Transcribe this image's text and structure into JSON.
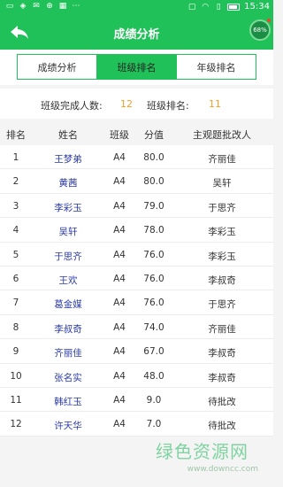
{
  "status_bar": {
    "time": "15:34",
    "icons": [
      "sim-icon",
      "shield-icon",
      "mail-icon",
      "globe-icon",
      "grid-icon",
      "dots-icon",
      "notification-icon",
      "wifi-icon",
      "sim-card-icon",
      "battery-icon"
    ]
  },
  "header": {
    "title": "成绩分析",
    "back_icon": "back-arrow-icon",
    "progress_badge": "68%"
  },
  "tabs": [
    {
      "label": "成绩分析",
      "active": false
    },
    {
      "label": "班级排名",
      "active": true
    },
    {
      "label": "年级排名",
      "active": false
    }
  ],
  "summary": {
    "completed_label": "班级完成人数:",
    "completed_value": "12",
    "rank_label": "班级排名:",
    "rank_value": "11"
  },
  "table": {
    "columns": [
      "排名",
      "姓名",
      "班级",
      "分值",
      "主观题批改人"
    ],
    "rows": [
      {
        "rank": "1",
        "name": "王梦弟",
        "class": "A4",
        "score": "80.0",
        "reviewer": "齐丽佳"
      },
      {
        "rank": "2",
        "name": "黄茜",
        "class": "A4",
        "score": "80.0",
        "reviewer": "吴轩"
      },
      {
        "rank": "3",
        "name": "李彩玉",
        "class": "A4",
        "score": "79.0",
        "reviewer": "于思齐"
      },
      {
        "rank": "4",
        "name": "吴轩",
        "class": "A4",
        "score": "78.0",
        "reviewer": "李彩玉"
      },
      {
        "rank": "5",
        "name": "于思齐",
        "class": "A4",
        "score": "76.0",
        "reviewer": "李彩玉"
      },
      {
        "rank": "6",
        "name": "王欢",
        "class": "A4",
        "score": "76.0",
        "reviewer": "李叔奇"
      },
      {
        "rank": "7",
        "name": "葛金媒",
        "class": "A4",
        "score": "76.0",
        "reviewer": "于思齐"
      },
      {
        "rank": "8",
        "name": "李叔奇",
        "class": "A4",
        "score": "74.0",
        "reviewer": "齐丽佳"
      },
      {
        "rank": "9",
        "name": "齐丽佳",
        "class": "A4",
        "score": "67.0",
        "reviewer": "李叔奇"
      },
      {
        "rank": "10",
        "name": "张名实",
        "class": "A4",
        "score": "48.0",
        "reviewer": "李叔奇"
      },
      {
        "rank": "11",
        "name": "韩红玉",
        "class": "A4",
        "score": "9.0",
        "reviewer": "待批改"
      },
      {
        "rank": "12",
        "name": "许天华",
        "class": "A4",
        "score": "7.0",
        "reviewer": "待批改"
      }
    ]
  },
  "watermark": {
    "title": "绿色资源网",
    "url": "www.downcc.com"
  },
  "colors": {
    "brand_green": "#21c15a",
    "value_orange": "#f0a020",
    "name_blue": "#2a3aa8"
  }
}
